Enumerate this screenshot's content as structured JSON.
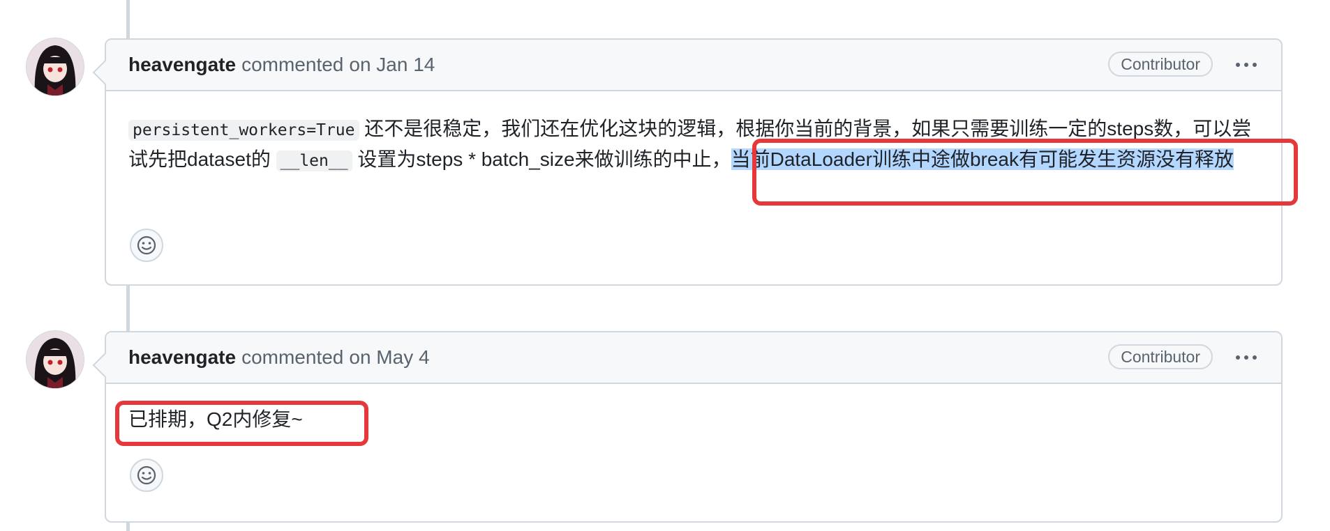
{
  "comments": [
    {
      "author": "heavengate",
      "action": "commented",
      "date": "on Jan 14",
      "badge": "Contributor",
      "body": {
        "code1": "persistent_workers=True",
        "text1": "还不是很稳定，我们还在优化这块的逻辑，根据你当前的背景，如果只需要训练一定的steps数，可以尝试先把dataset的",
        "code2": "__len__",
        "text2": "设置为steps * batch_size来做训练的中止，",
        "highlighted": "当前DataLoader训练中途做break有可能发生资源没有释放"
      }
    },
    {
      "author": "heavengate",
      "action": "commented",
      "date": "on May 4",
      "badge": "Contributor",
      "body": {
        "text1": "已排期，Q2内修复~"
      }
    }
  ],
  "icons": {
    "more": "kebab-horizontal-icon",
    "reaction": "smiley-icon"
  },
  "colors": {
    "annotation": "#e5383b",
    "selection": "#b3d7ff",
    "border": "#d0d7de"
  }
}
